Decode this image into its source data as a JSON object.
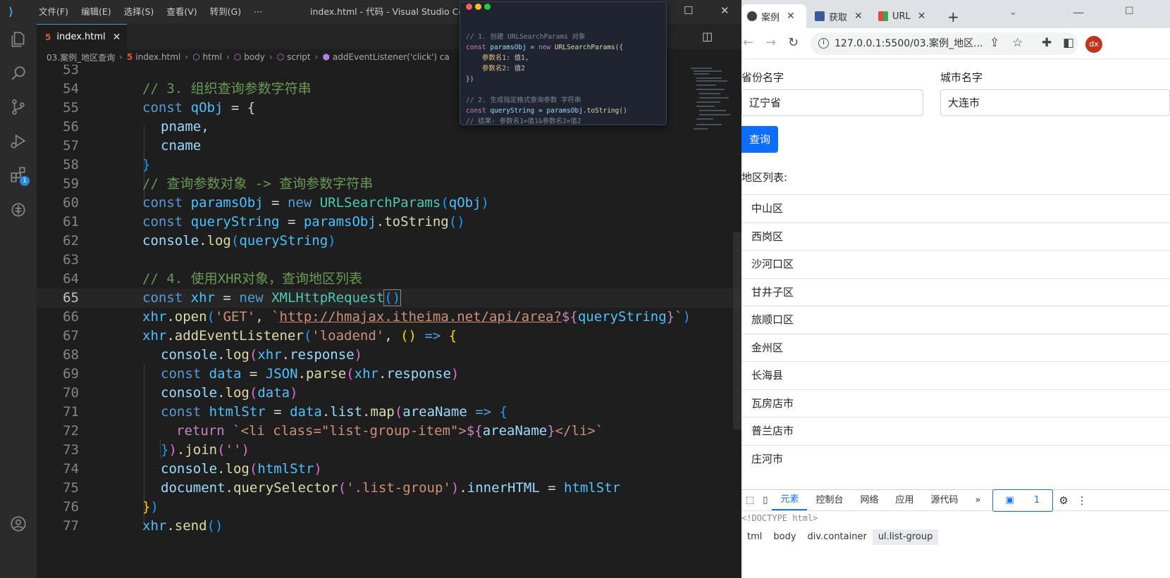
{
  "vscode": {
    "menu": [
      "文件(F)",
      "编辑(E)",
      "选择(S)",
      "查看(V)",
      "转到(G)",
      "···"
    ],
    "window_title": "index.html - 代码 - Visual Studio Code",
    "tab_label": "index.html",
    "breadcrumbs": [
      "03.案例_地区查询",
      "index.html",
      "html",
      "body",
      "script",
      "addEventListener('click') ca"
    ],
    "activity_badge": "1",
    "current_line": 65,
    "lines": [
      {
        "n": "53"
      },
      {
        "n": "54"
      },
      {
        "n": "55"
      },
      {
        "n": "56"
      },
      {
        "n": "57"
      },
      {
        "n": "58"
      },
      {
        "n": "59"
      },
      {
        "n": "60"
      },
      {
        "n": "61"
      },
      {
        "n": "62"
      },
      {
        "n": "63"
      },
      {
        "n": "64"
      },
      {
        "n": "65"
      },
      {
        "n": "66"
      },
      {
        "n": "67"
      },
      {
        "n": "68"
      },
      {
        "n": "69"
      },
      {
        "n": "70"
      },
      {
        "n": "71"
      },
      {
        "n": "72"
      },
      {
        "n": "73"
      },
      {
        "n": "74"
      },
      {
        "n": "75"
      },
      {
        "n": "76"
      },
      {
        "n": "77"
      }
    ],
    "code": {
      "l54": "// 3. 组织查询参数字符串",
      "l55a": "const",
      "l55b": "qObj",
      "l55c": " = {",
      "l56": "pname,",
      "l57": "cname",
      "l58": "}",
      "l59": "// 查询参数对象 -> 查询参数字符串",
      "l60a": "const",
      "l60b": "paramsObj",
      "l60c": " = ",
      "l60d": "new",
      "l60e": "URLSearchParams",
      "l60f": "(",
      "l60g": "qObj",
      "l60h": ")",
      "l61a": "const",
      "l61b": "queryString",
      "l61c": " = ",
      "l61d": "paramsObj",
      "l61e": ".",
      "l61f": "toString",
      "l61g": "()",
      "l62a": "console",
      "l62b": ".",
      "l62c": "log",
      "l62d": "(",
      "l62e": "queryString",
      "l62f": ")",
      "l64": "// 4. 使用XHR对象，查询地区列表",
      "l65a": "const",
      "l65b": "xhr",
      "l65c": " = ",
      "l65d": "new",
      "l65e": "XMLHttpRequest",
      "l65f": "()",
      "l66a": "xhr",
      "l66b": ".",
      "l66c": "open",
      "l66d": "(",
      "l66e": "'GET'",
      "l66f": ", ",
      "l66g": "`",
      "l66h": "http://hmajax.itheima.net/api/area?",
      "l66i": "${",
      "l66j": "queryString",
      "l66k": "}",
      "l66l": "`",
      "l66m": ")",
      "l67a": "xhr",
      "l67b": ".",
      "l67c": "addEventListener",
      "l67d": "(",
      "l67e": "'loadend'",
      "l67f": ", ",
      "l67g": "()",
      "l67h": " => ",
      "l67i": "{",
      "l68a": "console",
      "l68b": ".",
      "l68c": "log",
      "l68d": "(",
      "l68e": "xhr",
      "l68f": ".",
      "l68g": "response",
      "l68h": ")",
      "l69a": "const",
      "l69b": "data",
      "l69c": " = ",
      "l69d": "JSON",
      "l69e": ".",
      "l69f": "parse",
      "l69g": "(",
      "l69h": "xhr",
      "l69i": ".",
      "l69j": "response",
      "l69k": ")",
      "l70a": "console",
      "l70b": ".",
      "l70c": "log",
      "l70d": "(",
      "l70e": "data",
      "l70f": ")",
      "l71a": "const",
      "l71b": "htmlStr",
      "l71c": " = ",
      "l71d": "data",
      "l71e": ".",
      "l71f": "list",
      "l71g": ".",
      "l71h": "map",
      "l71i": "(",
      "l71j": "areaName",
      "l71k": " => ",
      "l71l": "{",
      "l72a": "return",
      "l72b": " `<li class=\"list-group-item\">",
      "l72c": "${",
      "l72d": "areaName",
      "l72e": "}",
      "l72f": "</li>`",
      "l73a": "}",
      "l73b": ")",
      "l73c": ".",
      "l73d": "join",
      "l73e": "(",
      "l73f": "''",
      "l73g": ")",
      "l74a": "console",
      "l74b": ".",
      "l74c": "log",
      "l74d": "(",
      "l74e": "htmlStr",
      "l74f": ")",
      "l75a": "document",
      "l75b": ".",
      "l75c": "querySelector",
      "l75d": "(",
      "l75e": "'.list-group'",
      "l75f": ")",
      "l75g": ".",
      "l75h": "innerHTML",
      "l75i": " = ",
      "l75j": "htmlStr",
      "l76a": "}",
      "l76b": ")",
      "l77a": "xhr",
      "l77b": ".",
      "l77c": "send",
      "l77d": "()"
    }
  },
  "snippet": {
    "l1": "// 1. 创建 URLSearchParams 对象",
    "l2a": "const",
    "l2b": " paramsObj = ",
    "l2c": "new",
    "l2d": " URLSearchParams",
    "l2e": "({",
    "l3a": "参数名1",
    "l3b": ": 值1,",
    "l4a": "参数名2",
    "l4b": ": 值2",
    "l5": "})",
    "l7": "// 2. 生成指定格式查询参数 字符串",
    "l8a": "const",
    "l8b": " queryString = paramsObj.",
    "l8c": "toString",
    "l8d": "()",
    "l9": "// 结果: 参数名1=值1&参数名2=值2"
  },
  "browser": {
    "tabs": [
      "案例",
      "获取",
      "URL"
    ],
    "url": "127.0.0.1:5500/03.案例_地区...",
    "avatar": "dx",
    "province_label": "省份名字",
    "province_value": "辽宁省",
    "city_label": "城市名字",
    "city_value": "大连市",
    "query_button": "查询",
    "list_label": "地区列表:",
    "areas": [
      "中山区",
      "西岗区",
      "沙河口区",
      "甘井子区",
      "旅顺口区",
      "金州区",
      "长海县",
      "瓦房店市",
      "普兰店市",
      "庄河市"
    ],
    "devtools": {
      "tabs": [
        "元素",
        "控制台",
        "网络",
        "应用",
        "源代码",
        "»"
      ],
      "issues_badge": "1",
      "doctype": "<!DOCTYPE html>",
      "crumbs": [
        "tml",
        "body",
        "div.container",
        "ul.list-group"
      ]
    }
  }
}
